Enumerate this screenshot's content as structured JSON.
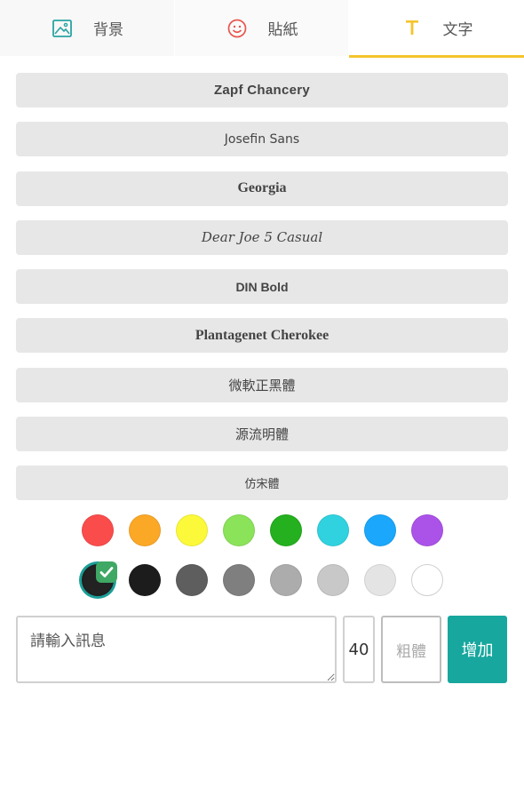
{
  "tabs": [
    {
      "label": "背景",
      "icon": "image-icon",
      "active": false
    },
    {
      "label": "貼紙",
      "icon": "smiley-icon",
      "active": false
    },
    {
      "label": "文字",
      "icon": "text-t-icon",
      "active": true
    }
  ],
  "fonts": [
    "Zapf Chancery",
    "Josefin Sans",
    "Georgia",
    "Dear Joe 5 Casual",
    "DIN Bold",
    "Plantagenet Cherokee",
    "微軟正黑體",
    "源流明體",
    "仿宋體"
  ],
  "colors": {
    "row1": [
      "#fb4c4c",
      "#fca827",
      "#fcf93a",
      "#8be35a",
      "#24b01f",
      "#30d2e0",
      "#1ba7fb",
      "#ab53e8"
    ],
    "row2": [
      "#222222",
      "#1c1c1c",
      "#5e5e5e",
      "#7f7f7f",
      "#acacac",
      "#c8c8c8",
      "#e4e4e4",
      "#ffffff"
    ],
    "selected_color": "#222222",
    "check_color": "#3fa864",
    "accent": "#17a79e",
    "tab_active_underline": "#f5c42c"
  },
  "input": {
    "placeholder": "請輸入訊息",
    "value": ""
  },
  "font_size": "40",
  "bold_label": "粗體",
  "add_label": "增加"
}
